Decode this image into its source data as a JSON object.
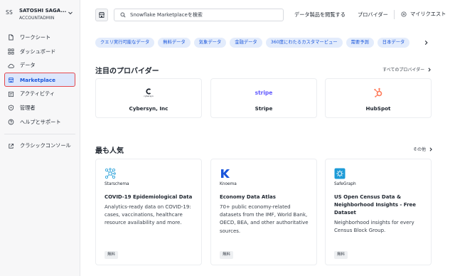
{
  "user": {
    "initials": "SS",
    "name": "SATOSHI SAGA...",
    "role": "ACCOUNTADMIN"
  },
  "sidebar": {
    "items": [
      {
        "label": "ワークシート",
        "icon": "document-icon"
      },
      {
        "label": "ダッシュボード",
        "icon": "dashboard-icon"
      },
      {
        "label": "データ",
        "icon": "cloud-icon"
      },
      {
        "label": "Marketplace",
        "icon": "marketplace-icon",
        "active": true
      },
      {
        "label": "アクティビティ",
        "icon": "activity-icon"
      },
      {
        "label": "管理者",
        "icon": "shield-icon"
      },
      {
        "label": "ヘルプとサポート",
        "icon": "help-icon"
      }
    ],
    "classic_label": "クラシックコンソール"
  },
  "topbar": {
    "search_placeholder": "Snowflake Marketplaceを検索",
    "browse_label": "データ製品を閲覧する",
    "providers_label": "プロバイダー",
    "my_requests_label": "マイリクエスト"
  },
  "chips": [
    "クエリ実行可能なデータ",
    "無料データ",
    "気象データ",
    "金融データ",
    "360度にわたるカスタマービュー",
    "需要予測",
    "日本データ"
  ],
  "featured": {
    "title": "注目のプロバイダー",
    "link": "すべてのプロバイダー",
    "providers": [
      {
        "name": "Cybersyn, Inc",
        "logo_text": "cybersyn"
      },
      {
        "name": "Stripe",
        "logo_text": "stripe"
      },
      {
        "name": "HubSpot",
        "logo_text": ""
      }
    ]
  },
  "popular": {
    "title": "最も人気",
    "link": "その他",
    "datasets": [
      {
        "provider": "Starschema",
        "title": "COVID-19 Epidemiological Data",
        "desc": "Analytics-ready data on COVID-19: cases, vaccinations, healthcare resource availability and more.",
        "badge": "無料"
      },
      {
        "provider": "Knoema",
        "title": "Economy Data Atlas",
        "desc": "70+ public economy-related datasets from the IMF, World Bank, OECD, BEA, and other authoritative sources.",
        "badge": "無料"
      },
      {
        "provider": "SafeGraph",
        "title": "US Open Census Data & Neighborhood Insights - Free Dataset",
        "desc": "Neighborhood insights for every Census Block Group.",
        "badge": "無料"
      }
    ]
  },
  "colors": {
    "accent": "#1a56db",
    "chip_bg": "#e3ecfc",
    "active_outline": "#e5484d",
    "stripe": "#635bff",
    "hubspot": "#ff7a59",
    "knoema": "#1a56db",
    "safegraph": "#1d9bd7"
  }
}
